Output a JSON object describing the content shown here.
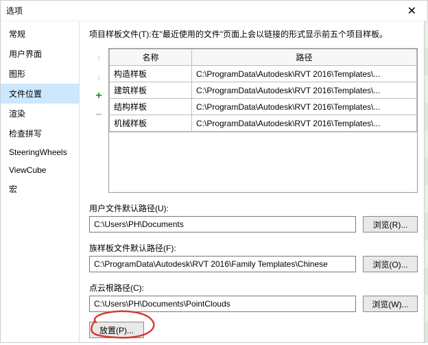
{
  "window": {
    "title": "选项"
  },
  "sidebar": {
    "items": [
      {
        "label": "常规"
      },
      {
        "label": "用户界面"
      },
      {
        "label": "图形"
      },
      {
        "label": "文件位置"
      },
      {
        "label": "渲染"
      },
      {
        "label": "检查拼写"
      },
      {
        "label": "SteeringWheels"
      },
      {
        "label": "ViewCube"
      },
      {
        "label": "宏"
      }
    ],
    "selected_index": 3
  },
  "main": {
    "description": "项目样板文件(T):在\"最近使用的文件\"页面上会以链接的形式显示前五个项目样板。",
    "table": {
      "headers": [
        "名称",
        "路径"
      ],
      "rows": [
        {
          "name": "构造样板",
          "path": "C:\\ProgramData\\Autodesk\\RVT 2016\\Templates\\..."
        },
        {
          "name": "建筑样板",
          "path": "C:\\ProgramData\\Autodesk\\RVT 2016\\Templates\\..."
        },
        {
          "name": "结构样板",
          "path": "C:\\ProgramData\\Autodesk\\RVT 2016\\Templates\\..."
        },
        {
          "name": "机械样板",
          "path": "C:\\ProgramData\\Autodesk\\RVT 2016\\Templates\\..."
        }
      ]
    },
    "toolbar_buttons": {
      "up": "↑",
      "down": "↓",
      "add": "+",
      "remove": "−"
    },
    "fields": [
      {
        "label": "用户文件默认路径(U):",
        "value": "C:\\Users\\PH\\Documents",
        "browse": "浏览(R)..."
      },
      {
        "label": "族样板文件默认路径(F):",
        "value": "C:\\ProgramData\\Autodesk\\RVT 2016\\Family Templates\\Chinese",
        "browse": "浏览(O)..."
      },
      {
        "label": "点云根路径(C):",
        "value": "C:\\Users\\PH\\Documents\\PointClouds",
        "browse": "浏览(W)..."
      }
    ],
    "place_button": "放置(P)..."
  }
}
